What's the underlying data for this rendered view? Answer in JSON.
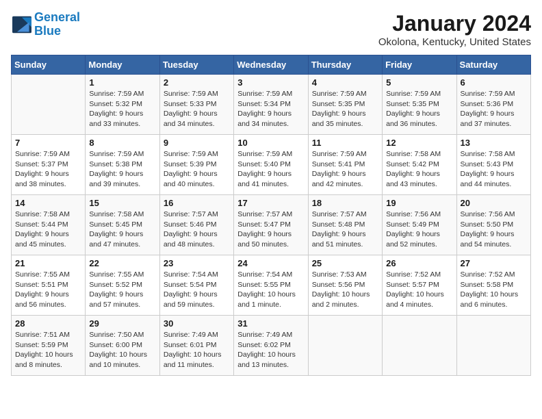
{
  "header": {
    "logo_line1": "General",
    "logo_line2": "Blue",
    "month_title": "January 2024",
    "location": "Okolona, Kentucky, United States"
  },
  "days_of_week": [
    "Sunday",
    "Monday",
    "Tuesday",
    "Wednesday",
    "Thursday",
    "Friday",
    "Saturday"
  ],
  "weeks": [
    [
      {
        "day": "",
        "info": ""
      },
      {
        "day": "1",
        "info": "Sunrise: 7:59 AM\nSunset: 5:32 PM\nDaylight: 9 hours\nand 33 minutes."
      },
      {
        "day": "2",
        "info": "Sunrise: 7:59 AM\nSunset: 5:33 PM\nDaylight: 9 hours\nand 34 minutes."
      },
      {
        "day": "3",
        "info": "Sunrise: 7:59 AM\nSunset: 5:34 PM\nDaylight: 9 hours\nand 34 minutes."
      },
      {
        "day": "4",
        "info": "Sunrise: 7:59 AM\nSunset: 5:35 PM\nDaylight: 9 hours\nand 35 minutes."
      },
      {
        "day": "5",
        "info": "Sunrise: 7:59 AM\nSunset: 5:35 PM\nDaylight: 9 hours\nand 36 minutes."
      },
      {
        "day": "6",
        "info": "Sunrise: 7:59 AM\nSunset: 5:36 PM\nDaylight: 9 hours\nand 37 minutes."
      }
    ],
    [
      {
        "day": "7",
        "info": "Sunrise: 7:59 AM\nSunset: 5:37 PM\nDaylight: 9 hours\nand 38 minutes."
      },
      {
        "day": "8",
        "info": "Sunrise: 7:59 AM\nSunset: 5:38 PM\nDaylight: 9 hours\nand 39 minutes."
      },
      {
        "day": "9",
        "info": "Sunrise: 7:59 AM\nSunset: 5:39 PM\nDaylight: 9 hours\nand 40 minutes."
      },
      {
        "day": "10",
        "info": "Sunrise: 7:59 AM\nSunset: 5:40 PM\nDaylight: 9 hours\nand 41 minutes."
      },
      {
        "day": "11",
        "info": "Sunrise: 7:59 AM\nSunset: 5:41 PM\nDaylight: 9 hours\nand 42 minutes."
      },
      {
        "day": "12",
        "info": "Sunrise: 7:58 AM\nSunset: 5:42 PM\nDaylight: 9 hours\nand 43 minutes."
      },
      {
        "day": "13",
        "info": "Sunrise: 7:58 AM\nSunset: 5:43 PM\nDaylight: 9 hours\nand 44 minutes."
      }
    ],
    [
      {
        "day": "14",
        "info": "Sunrise: 7:58 AM\nSunset: 5:44 PM\nDaylight: 9 hours\nand 45 minutes."
      },
      {
        "day": "15",
        "info": "Sunrise: 7:58 AM\nSunset: 5:45 PM\nDaylight: 9 hours\nand 47 minutes."
      },
      {
        "day": "16",
        "info": "Sunrise: 7:57 AM\nSunset: 5:46 PM\nDaylight: 9 hours\nand 48 minutes."
      },
      {
        "day": "17",
        "info": "Sunrise: 7:57 AM\nSunset: 5:47 PM\nDaylight: 9 hours\nand 50 minutes."
      },
      {
        "day": "18",
        "info": "Sunrise: 7:57 AM\nSunset: 5:48 PM\nDaylight: 9 hours\nand 51 minutes."
      },
      {
        "day": "19",
        "info": "Sunrise: 7:56 AM\nSunset: 5:49 PM\nDaylight: 9 hours\nand 52 minutes."
      },
      {
        "day": "20",
        "info": "Sunrise: 7:56 AM\nSunset: 5:50 PM\nDaylight: 9 hours\nand 54 minutes."
      }
    ],
    [
      {
        "day": "21",
        "info": "Sunrise: 7:55 AM\nSunset: 5:51 PM\nDaylight: 9 hours\nand 56 minutes."
      },
      {
        "day": "22",
        "info": "Sunrise: 7:55 AM\nSunset: 5:52 PM\nDaylight: 9 hours\nand 57 minutes."
      },
      {
        "day": "23",
        "info": "Sunrise: 7:54 AM\nSunset: 5:54 PM\nDaylight: 9 hours\nand 59 minutes."
      },
      {
        "day": "24",
        "info": "Sunrise: 7:54 AM\nSunset: 5:55 PM\nDaylight: 10 hours\nand 1 minute."
      },
      {
        "day": "25",
        "info": "Sunrise: 7:53 AM\nSunset: 5:56 PM\nDaylight: 10 hours\nand 2 minutes."
      },
      {
        "day": "26",
        "info": "Sunrise: 7:52 AM\nSunset: 5:57 PM\nDaylight: 10 hours\nand 4 minutes."
      },
      {
        "day": "27",
        "info": "Sunrise: 7:52 AM\nSunset: 5:58 PM\nDaylight: 10 hours\nand 6 minutes."
      }
    ],
    [
      {
        "day": "28",
        "info": "Sunrise: 7:51 AM\nSunset: 5:59 PM\nDaylight: 10 hours\nand 8 minutes."
      },
      {
        "day": "29",
        "info": "Sunrise: 7:50 AM\nSunset: 6:00 PM\nDaylight: 10 hours\nand 10 minutes."
      },
      {
        "day": "30",
        "info": "Sunrise: 7:49 AM\nSunset: 6:01 PM\nDaylight: 10 hours\nand 11 minutes."
      },
      {
        "day": "31",
        "info": "Sunrise: 7:49 AM\nSunset: 6:02 PM\nDaylight: 10 hours\nand 13 minutes."
      },
      {
        "day": "",
        "info": ""
      },
      {
        "day": "",
        "info": ""
      },
      {
        "day": "",
        "info": ""
      }
    ]
  ]
}
